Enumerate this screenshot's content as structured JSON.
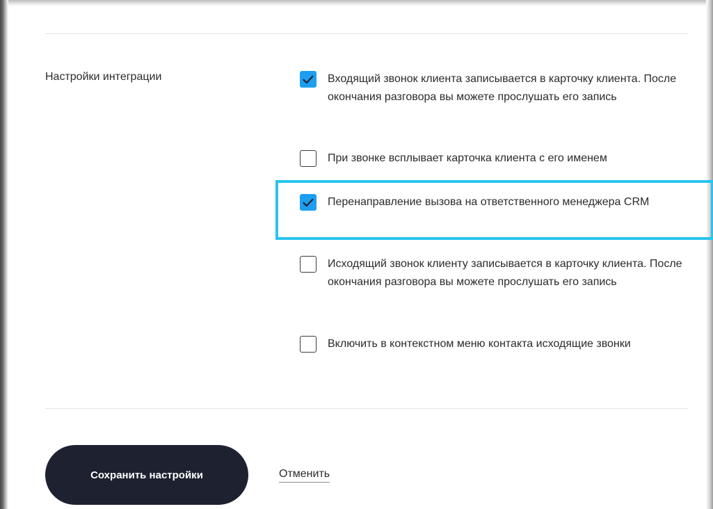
{
  "integration": {
    "label": "Настройки интеграции",
    "options": [
      {
        "text": "Входящий звонок клиента записывается в карточку клиента. После окончания разговора вы можете прослушать его запись",
        "checked": true
      },
      {
        "text": "При звонке всплывает карточка клиента с его именем",
        "checked": false
      },
      {
        "text": "Перенаправление вызова на ответственного менеджера CRM",
        "checked": true,
        "highlighted": true
      },
      {
        "text": "Исходящий звонок клиенту записывается в карточку клиента. После окончания разговора вы можете прослушать его запись",
        "checked": false
      },
      {
        "text": "Включить в контекстном меню контакта исходящие звонки",
        "checked": false
      }
    ]
  },
  "actions": {
    "save_label": "Сохранить настройки",
    "cancel_label": "Отменить"
  },
  "colors": {
    "checkbox_checked": "#1e9ef0",
    "highlight_border": "#29c3ee",
    "button_bg": "#1e2230"
  }
}
